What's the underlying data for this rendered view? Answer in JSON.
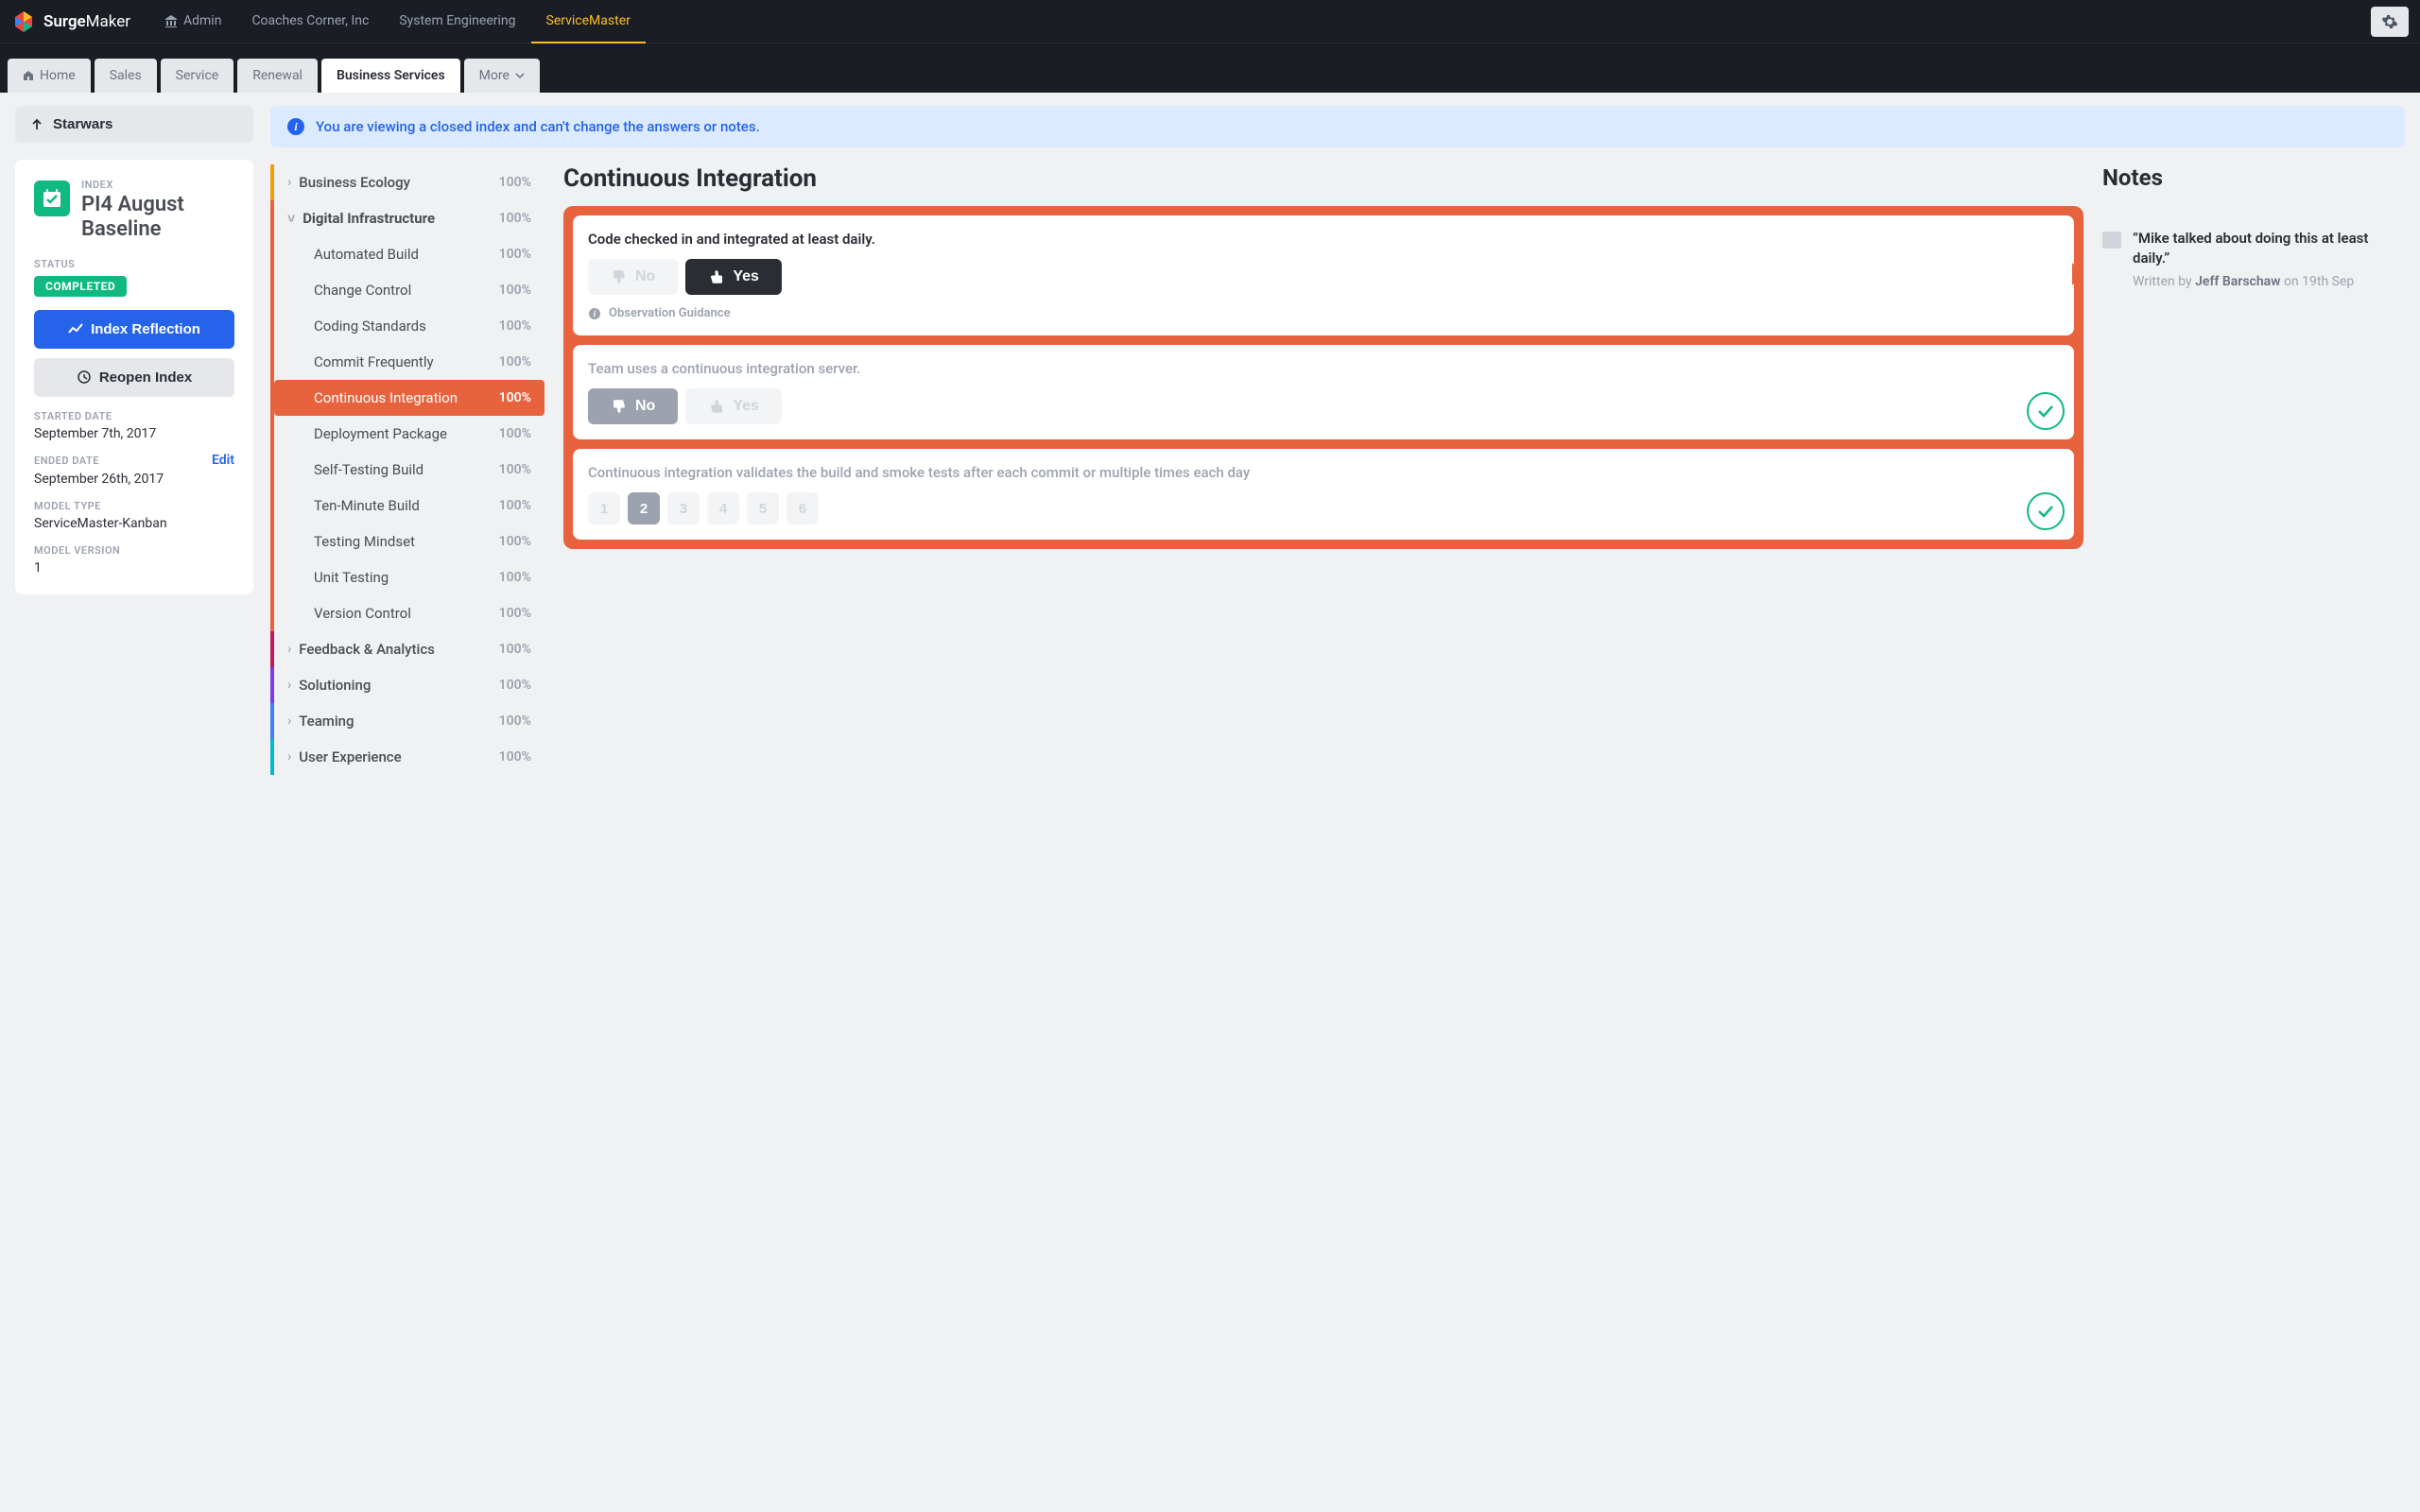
{
  "brand": {
    "name_a": "Surge",
    "name_b": "Maker"
  },
  "topNav": {
    "items": [
      {
        "label": "Admin"
      },
      {
        "label": "Coaches Corner, Inc"
      },
      {
        "label": "System Engineering"
      },
      {
        "label": "ServiceMaster",
        "active": true
      }
    ]
  },
  "tabs": {
    "items": [
      {
        "label": "Home"
      },
      {
        "label": "Sales"
      },
      {
        "label": "Service"
      },
      {
        "label": "Renewal"
      },
      {
        "label": "Business Services",
        "active": true
      },
      {
        "label": "More"
      }
    ]
  },
  "breadcrumb": "Starwars",
  "index": {
    "label": "INDEX",
    "title": "PI4 August Baseline",
    "statusLabel": "STATUS",
    "statusValue": "COMPLETED",
    "reflectionBtn": "Index Reflection",
    "reopenBtn": "Reopen Index",
    "startedLabel": "STARTED DATE",
    "startedValue": "September 7th, 2017",
    "endedLabel": "ENDED DATE",
    "endedValue": "September 26th, 2017",
    "editLink": "Edit",
    "modelTypeLabel": "MODEL TYPE",
    "modelTypeValue": "ServiceMaster-Kanban",
    "modelVersionLabel": "MODEL VERSION",
    "modelVersionValue": "1"
  },
  "alert": "You are viewing a closed index and can't change the answers or notes.",
  "categories": [
    {
      "name": "Business Ecology",
      "pct": "100%",
      "color": "#f59e0b",
      "expanded": false
    },
    {
      "name": "Digital Infrastructure",
      "pct": "100%",
      "color": "#e8633d",
      "expanded": true,
      "sub": [
        {
          "name": "Automated Build",
          "pct": "100%"
        },
        {
          "name": "Change Control",
          "pct": "100%"
        },
        {
          "name": "Coding Standards",
          "pct": "100%"
        },
        {
          "name": "Commit Frequently",
          "pct": "100%"
        },
        {
          "name": "Continuous Integration",
          "pct": "100%",
          "active": true
        },
        {
          "name": "Deployment Package",
          "pct": "100%"
        },
        {
          "name": "Self-Testing Build",
          "pct": "100%"
        },
        {
          "name": "Ten-Minute Build",
          "pct": "100%"
        },
        {
          "name": "Testing Mindset",
          "pct": "100%"
        },
        {
          "name": "Unit Testing",
          "pct": "100%"
        },
        {
          "name": "Version Control",
          "pct": "100%"
        }
      ]
    },
    {
      "name": "Feedback & Analytics",
      "pct": "100%",
      "color": "#be185d",
      "expanded": false
    },
    {
      "name": "Solutioning",
      "pct": "100%",
      "color": "#7c3aed",
      "expanded": false
    },
    {
      "name": "Teaming",
      "pct": "100%",
      "color": "#3b82f6",
      "expanded": false
    },
    {
      "name": "User Experience",
      "pct": "100%",
      "color": "#06b6d4",
      "expanded": false
    }
  ],
  "questions": {
    "title": "Continuous Integration",
    "items": [
      {
        "text": "Code checked in and integrated at least daily.",
        "noLabel": "No",
        "yesLabel": "Yes",
        "answer": "yes",
        "guidance": "Observation Guidance"
      },
      {
        "text": "Team uses a continuous integration server.",
        "noLabel": "No",
        "yesLabel": "Yes",
        "answer": "no",
        "checked": true
      },
      {
        "text": "Continuous integration validates the build and smoke tests after each commit or multiple times each day",
        "scale": [
          "1",
          "2",
          "3",
          "4",
          "5",
          "6"
        ],
        "selected": "2",
        "checked": true
      }
    ]
  },
  "notes": {
    "title": "Notes",
    "items": [
      {
        "quote": "“Mike talked about doing this at least daily.”",
        "writtenBy": "Written by ",
        "author": "Jeff Barschaw",
        "on": " on 19th Sep"
      }
    ]
  }
}
